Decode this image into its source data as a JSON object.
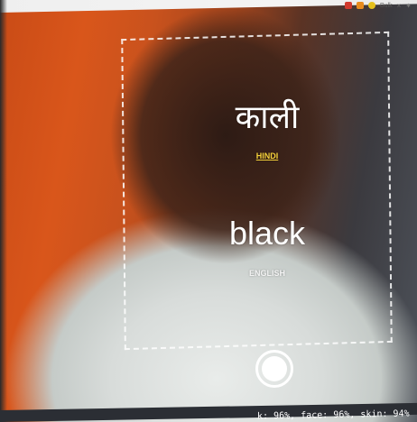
{
  "tray": {
    "items": [
      "Bulk"
    ],
    "close_glyph": "×"
  },
  "translation": {
    "native_word": "काली",
    "native_language": "HINDI",
    "translated_word": "black",
    "translated_language": "ENGLISH"
  },
  "colors": {
    "native_language_accent": "#f5d23a",
    "text": "#ffffff",
    "frame_border": "#ffffff"
  },
  "capture": {
    "icon": "camera-shutter-icon"
  },
  "stats": {
    "text": "k: 96%, face: 96%, skin: 94%"
  }
}
